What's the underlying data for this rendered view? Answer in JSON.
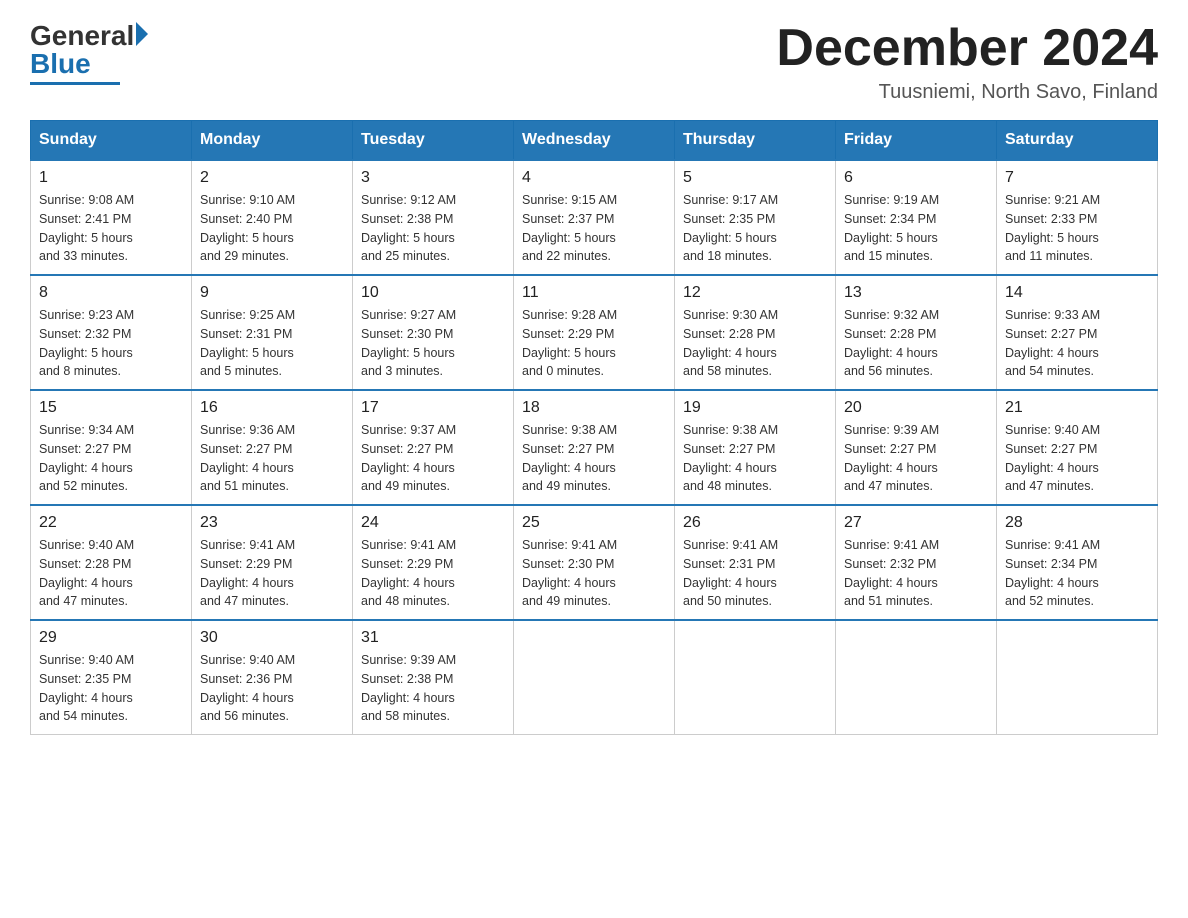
{
  "header": {
    "logo_general": "General",
    "logo_blue": "Blue",
    "month_title": "December 2024",
    "location": "Tuusniemi, North Savo, Finland"
  },
  "weekdays": [
    "Sunday",
    "Monday",
    "Tuesday",
    "Wednesday",
    "Thursday",
    "Friday",
    "Saturday"
  ],
  "weeks": [
    [
      {
        "day": "1",
        "sunrise": "9:08 AM",
        "sunset": "2:41 PM",
        "daylight": "5 hours and 33 minutes."
      },
      {
        "day": "2",
        "sunrise": "9:10 AM",
        "sunset": "2:40 PM",
        "daylight": "5 hours and 29 minutes."
      },
      {
        "day": "3",
        "sunrise": "9:12 AM",
        "sunset": "2:38 PM",
        "daylight": "5 hours and 25 minutes."
      },
      {
        "day": "4",
        "sunrise": "9:15 AM",
        "sunset": "2:37 PM",
        "daylight": "5 hours and 22 minutes."
      },
      {
        "day": "5",
        "sunrise": "9:17 AM",
        "sunset": "2:35 PM",
        "daylight": "5 hours and 18 minutes."
      },
      {
        "day": "6",
        "sunrise": "9:19 AM",
        "sunset": "2:34 PM",
        "daylight": "5 hours and 15 minutes."
      },
      {
        "day": "7",
        "sunrise": "9:21 AM",
        "sunset": "2:33 PM",
        "daylight": "5 hours and 11 minutes."
      }
    ],
    [
      {
        "day": "8",
        "sunrise": "9:23 AM",
        "sunset": "2:32 PM",
        "daylight": "5 hours and 8 minutes."
      },
      {
        "day": "9",
        "sunrise": "9:25 AM",
        "sunset": "2:31 PM",
        "daylight": "5 hours and 5 minutes."
      },
      {
        "day": "10",
        "sunrise": "9:27 AM",
        "sunset": "2:30 PM",
        "daylight": "5 hours and 3 minutes."
      },
      {
        "day": "11",
        "sunrise": "9:28 AM",
        "sunset": "2:29 PM",
        "daylight": "5 hours and 0 minutes."
      },
      {
        "day": "12",
        "sunrise": "9:30 AM",
        "sunset": "2:28 PM",
        "daylight": "4 hours and 58 minutes."
      },
      {
        "day": "13",
        "sunrise": "9:32 AM",
        "sunset": "2:28 PM",
        "daylight": "4 hours and 56 minutes."
      },
      {
        "day": "14",
        "sunrise": "9:33 AM",
        "sunset": "2:27 PM",
        "daylight": "4 hours and 54 minutes."
      }
    ],
    [
      {
        "day": "15",
        "sunrise": "9:34 AM",
        "sunset": "2:27 PM",
        "daylight": "4 hours and 52 minutes."
      },
      {
        "day": "16",
        "sunrise": "9:36 AM",
        "sunset": "2:27 PM",
        "daylight": "4 hours and 51 minutes."
      },
      {
        "day": "17",
        "sunrise": "9:37 AM",
        "sunset": "2:27 PM",
        "daylight": "4 hours and 49 minutes."
      },
      {
        "day": "18",
        "sunrise": "9:38 AM",
        "sunset": "2:27 PM",
        "daylight": "4 hours and 49 minutes."
      },
      {
        "day": "19",
        "sunrise": "9:38 AM",
        "sunset": "2:27 PM",
        "daylight": "4 hours and 48 minutes."
      },
      {
        "day": "20",
        "sunrise": "9:39 AM",
        "sunset": "2:27 PM",
        "daylight": "4 hours and 47 minutes."
      },
      {
        "day": "21",
        "sunrise": "9:40 AM",
        "sunset": "2:27 PM",
        "daylight": "4 hours and 47 minutes."
      }
    ],
    [
      {
        "day": "22",
        "sunrise": "9:40 AM",
        "sunset": "2:28 PM",
        "daylight": "4 hours and 47 minutes."
      },
      {
        "day": "23",
        "sunrise": "9:41 AM",
        "sunset": "2:29 PM",
        "daylight": "4 hours and 47 minutes."
      },
      {
        "day": "24",
        "sunrise": "9:41 AM",
        "sunset": "2:29 PM",
        "daylight": "4 hours and 48 minutes."
      },
      {
        "day": "25",
        "sunrise": "9:41 AM",
        "sunset": "2:30 PM",
        "daylight": "4 hours and 49 minutes."
      },
      {
        "day": "26",
        "sunrise": "9:41 AM",
        "sunset": "2:31 PM",
        "daylight": "4 hours and 50 minutes."
      },
      {
        "day": "27",
        "sunrise": "9:41 AM",
        "sunset": "2:32 PM",
        "daylight": "4 hours and 51 minutes."
      },
      {
        "day": "28",
        "sunrise": "9:41 AM",
        "sunset": "2:34 PM",
        "daylight": "4 hours and 52 minutes."
      }
    ],
    [
      {
        "day": "29",
        "sunrise": "9:40 AM",
        "sunset": "2:35 PM",
        "daylight": "4 hours and 54 minutes."
      },
      {
        "day": "30",
        "sunrise": "9:40 AM",
        "sunset": "2:36 PM",
        "daylight": "4 hours and 56 minutes."
      },
      {
        "day": "31",
        "sunrise": "9:39 AM",
        "sunset": "2:38 PM",
        "daylight": "4 hours and 58 minutes."
      },
      null,
      null,
      null,
      null
    ]
  ],
  "labels": {
    "sunrise": "Sunrise:",
    "sunset": "Sunset:",
    "daylight": "Daylight:"
  }
}
